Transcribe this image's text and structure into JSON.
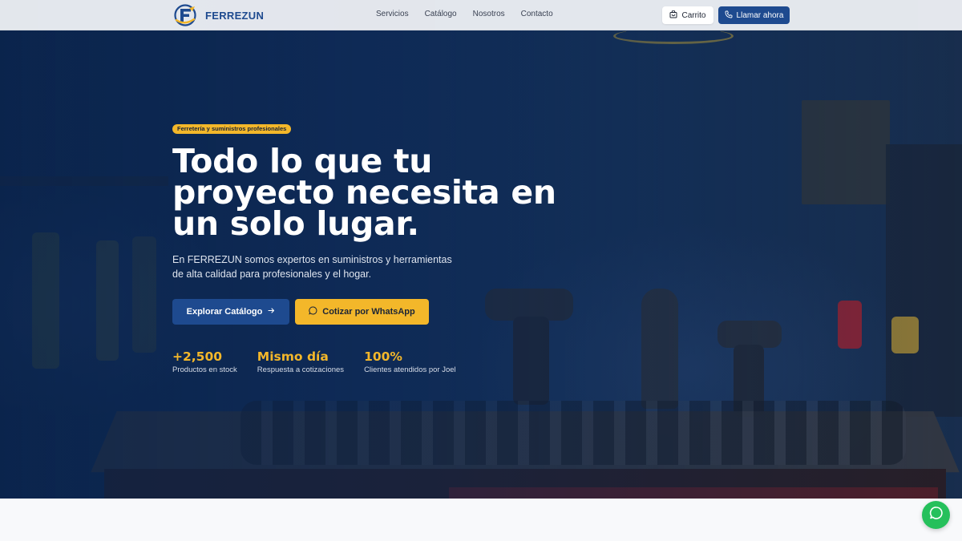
{
  "header": {
    "brand": "FERREZUN",
    "nav": [
      "Servicios",
      "Catálogo",
      "Nosotros",
      "Contacto"
    ],
    "cart_label": "Carrito",
    "call_label": "Llamar ahora"
  },
  "hero": {
    "badge": "Ferretería y suministros profesionales",
    "headline": "Todo lo que tu proyecto necesita en un solo lugar.",
    "subtitle": "En FERREZUN somos expertos en suministros y herramientas de alta calidad para profesionales y el hogar.",
    "primary_cta": "Explorar Catálogo",
    "secondary_cta": "Cotizar por WhatsApp",
    "stats": [
      {
        "value": "+2,500",
        "label": "Productos en stock"
      },
      {
        "value": "Mismo día",
        "label": "Respuesta a cotizaciones"
      },
      {
        "value": "100%",
        "label": "Clientes atendidos por Joel"
      }
    ]
  },
  "icons": {
    "logo": "ferrezun-logo",
    "cart": "cart-icon",
    "call": "phone-icon",
    "arrow": "arrow-right-icon",
    "whatsapp": "whatsapp-icon",
    "fab": "whatsapp-float-icon"
  },
  "colors": {
    "primary": "#1e4a8f",
    "accent": "#f3b72a",
    "whatsapp": "#25c05b"
  }
}
